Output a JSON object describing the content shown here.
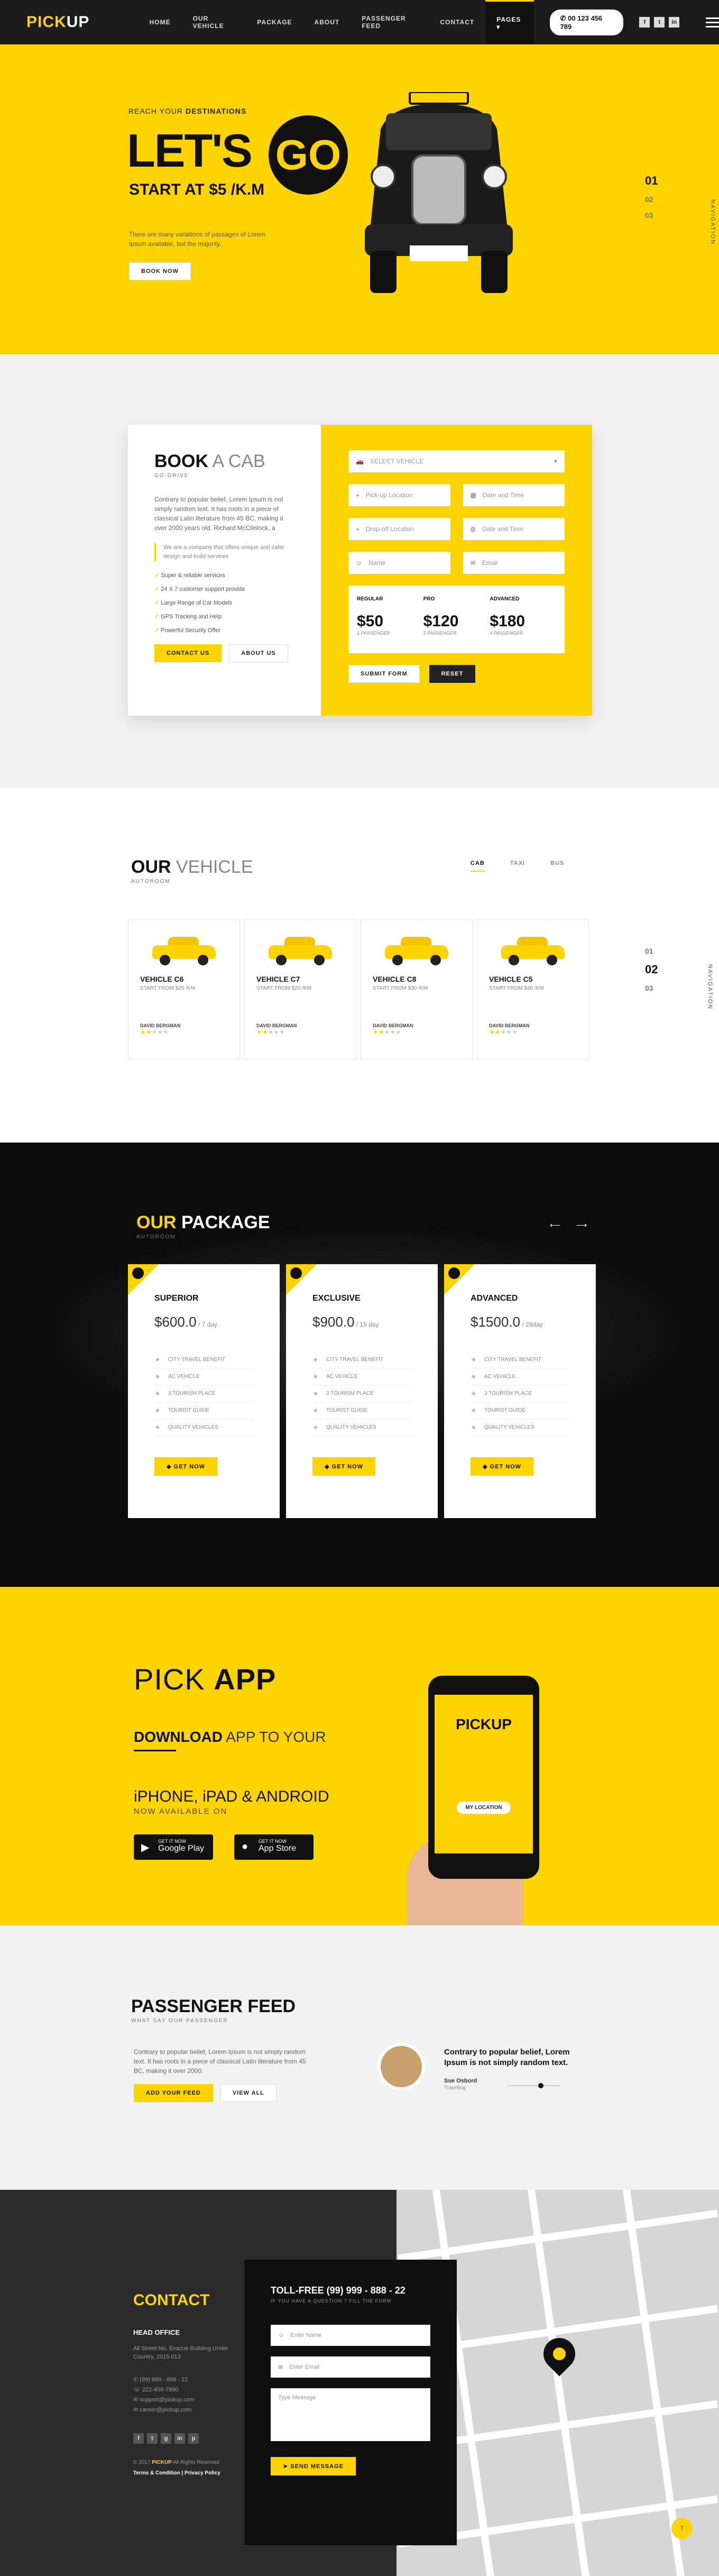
{
  "header": {
    "logo_a": "P",
    "logo_b": "ICK",
    "logo_c": "UP",
    "nav": [
      "HOME",
      "OUR VEHICLE",
      "PACKAGE",
      "ABOUT",
      "PASSENGER FEED",
      "CONTACT",
      "PAGES ▾"
    ],
    "phone": "00 123 456 789",
    "social": [
      "f",
      "t",
      "in"
    ]
  },
  "hero": {
    "sub_a": "REACH YOUR ",
    "sub_b": "DESTINATIONS",
    "title": "LET'S",
    "go": "GO",
    "price": "START AT $5 /K.M",
    "desc": "There are many variations of passages of Lorem Ipsum available, but the majority.",
    "button": "BOOK NOW",
    "slides": [
      "01",
      "02",
      "03"
    ],
    "vertical": "NAVIGATION"
  },
  "booking": {
    "title_a": "BOOK",
    "title_b": " A CAB",
    "sub": "GO-DRIVE",
    "desc": "Contrary to popular belief, Lorem Ipsum is not simply random text. It has roots in a piece of classical Latin literature from 45 BC, making it over 2000 years old. Richard McClintock, a",
    "quote": "We are a company that offers unique and safer design and build services",
    "features": [
      "Super & reliable services",
      "24 X 7 customer support provide",
      "Large Range of Car Models",
      "GPS Tracking and Help",
      "Powerful Security Offer"
    ],
    "contact_btn": "CONTACT US",
    "about_btn": "ABOUT US",
    "vehicle_select": "SELECT VEHICLE",
    "pickup": "Pick-up Location",
    "dropoff": "Drop-off Location",
    "date1": "Date and Time",
    "date2": "Date and Time",
    "name": "Name",
    "email": "Email",
    "fares": [
      {
        "name": "REGULAR",
        "price": "$50",
        "pass": "1 PASSENGER"
      },
      {
        "name": "PRO",
        "price": "$120",
        "pass": "2 PASSENGER"
      },
      {
        "name": "ADVANCED",
        "price": "$180",
        "pass": "4 PASSENGER"
      }
    ],
    "submit": "SUBMIT FORM",
    "reset": "RESET"
  },
  "vehicles": {
    "title_a": "OUR",
    "title_b": " VEHICLE",
    "sub": "AUTOROOM",
    "tabs": [
      "CAB",
      "TAXI",
      "BUS"
    ],
    "cards": [
      {
        "name": "VEHICLE C6",
        "price": "START FROM $25 /KM",
        "owner": "DAVID BERGMAN"
      },
      {
        "name": "VEHICLE C7",
        "price": "START FROM $20 /KM",
        "owner": "DAVID BERGMAN"
      },
      {
        "name": "VEHICLE C8",
        "price": "START FROM $30 /KM",
        "owner": "DAVID BERGMAN"
      },
      {
        "name": "VEHICLE C5",
        "price": "START FROM $40 /KM",
        "owner": "DAVID BERGMAN"
      }
    ],
    "slides": [
      "01",
      "02",
      "03"
    ],
    "vertical": "NAVIGATION"
  },
  "package": {
    "title_a": "OUR",
    "title_b": " PACKAGE",
    "sub": "AUTOROOM",
    "cards": [
      {
        "name": "SUPERIOR",
        "price": "$600.0",
        "per": " / 7 day",
        "features": [
          "CITY TRAVEL BENEFIT",
          "AC VEHICLE",
          "3 TOURISM PLACE",
          "TOURIST GUIDE",
          "QUALITY VEHICLES"
        ],
        "button": "GET NOW"
      },
      {
        "name": "EXCLUSIVE",
        "price": "$900.0",
        "per": " / 15 day",
        "features": [
          "CITY TRAVEL BENEFIT",
          "AC VEHICLE",
          "3 TOURISM PLACE",
          "TOURIST GUIDE",
          "QUALITY VEHICLES"
        ],
        "button": "GET NOW"
      },
      {
        "name": "ADVANCED",
        "price": "$1500.0",
        "per": " / 28day",
        "features": [
          "CITY TRAVEL BENEFIT",
          "AC VEHICLE",
          "3 TOURISM PLACE",
          "TOURIST GUIDE",
          "QUALITY VEHICLES"
        ],
        "button": "GET NOW"
      }
    ]
  },
  "app": {
    "title_a": "PICK ",
    "title_b": "APP",
    "sub_a": "DOWNLOAD",
    "sub_b": " APP TO YOUR",
    "devices": "iPHONE, iPAD & ANDROID",
    "avail": "NOW AVAILABLE ON",
    "gp_small": "GET IT NOW",
    "gp_big": "Google Play",
    "as_small": "GET IT NOW",
    "as_big": "App Store",
    "phone_logo": "PICKUP",
    "phone_btn": "MY LOCATION"
  },
  "feed": {
    "title_a": "PASSENGER",
    "title_b": " FEED",
    "sub": "WHAT SAY OUR PASSENGER",
    "desc": "Contrary to popular belief, Lorem Ipsum is not simply random text. It has roots in a piece of classical Latin literature from 45 BC, making it over 2000.",
    "btn1": "ADD YOUR FEED",
    "btn2": "VIEW ALL",
    "quote": "Contrary to popular belief, Lorem Ipsum is not simply random text.",
    "name": "Sue Osbord",
    "role": "Traveling"
  },
  "contact": {
    "title": "CONTACT",
    "head": "HEAD OFFICE",
    "addr": "All Street No, Evacue Building Under Country, 2015 013",
    "lines": [
      "(99) 999 - 888 - 22",
      "222-456-7890",
      "support@pickup.com",
      "career@pickup.com"
    ],
    "social": [
      "f",
      "t",
      "g",
      "in",
      "p"
    ],
    "copy_a": "© 2017 ",
    "copy_b": "PICKUP",
    "copy_c": " All Rights Reserved",
    "links": "Terms & Condition  |  Privacy Policy",
    "form_title": "TOLL-FREE (99) 999 - 888 - 22",
    "form_sub": "IF YOU HAVE A QUESTION ? FILL THE FORM",
    "name_ph": "Enter Name",
    "email_ph": "Enter Email",
    "msg_ph": "Type Message",
    "send": "SEND MESSAGE"
  }
}
